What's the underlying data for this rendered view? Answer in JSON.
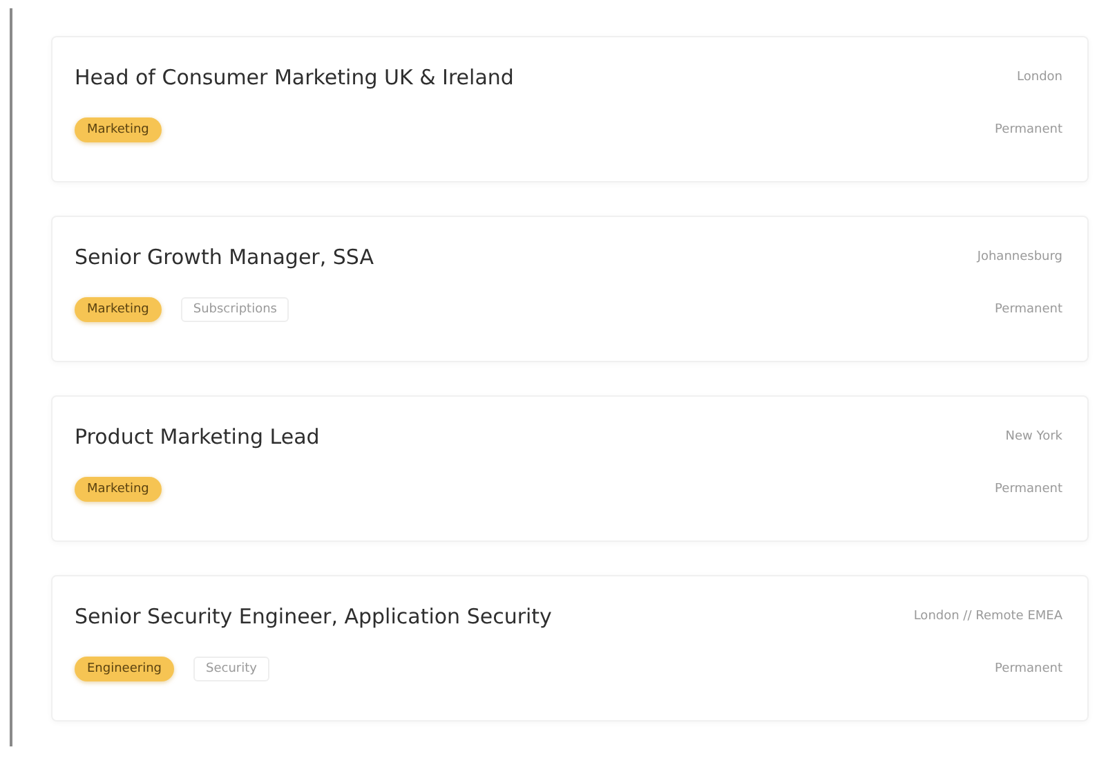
{
  "jobs": [
    {
      "title": "Head of Consumer Marketing UK & Ireland",
      "location": "London",
      "tags": [
        {
          "label": "Marketing",
          "kind": "primary"
        }
      ],
      "type": "Permanent"
    },
    {
      "title": "Senior Growth Manager, SSA",
      "location": "Johannesburg",
      "tags": [
        {
          "label": "Marketing",
          "kind": "primary"
        },
        {
          "label": "Subscriptions",
          "kind": "secondary"
        }
      ],
      "type": "Permanent"
    },
    {
      "title": "Product Marketing Lead",
      "location": "New York",
      "tags": [
        {
          "label": "Marketing",
          "kind": "primary"
        }
      ],
      "type": "Permanent"
    },
    {
      "title": "Senior Security Engineer, Application Security",
      "location": "London // Remote EMEA",
      "tags": [
        {
          "label": "Engineering",
          "kind": "primary"
        },
        {
          "label": "Security",
          "kind": "secondary"
        }
      ],
      "type": "Permanent"
    }
  ]
}
